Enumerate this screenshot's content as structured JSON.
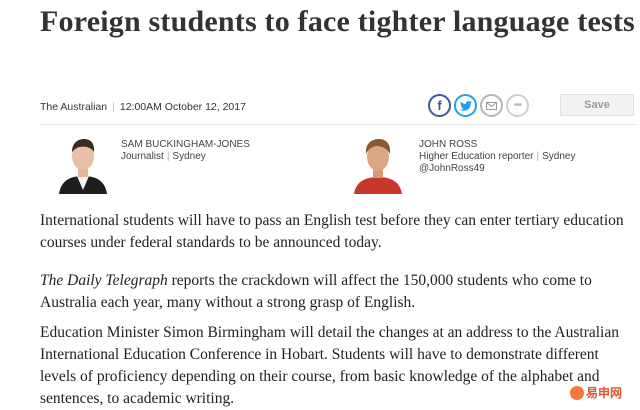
{
  "article": {
    "headline": "Foreign students to face tighter language tests",
    "publication": "The Australian",
    "timestamp": "12:00AM October 12, 2017"
  },
  "toolbar": {
    "facebook_icon": "facebook-icon",
    "twitter_icon": "twitter-icon",
    "email_icon": "email-icon",
    "more_icon": "more-icon",
    "save_label": "Save"
  },
  "authors": [
    {
      "name": "SAM BUCKINGHAM-JONES",
      "role": "Journalist",
      "location": "Sydney",
      "handle": ""
    },
    {
      "name": "JOHN ROSS",
      "role": "Higher Education reporter",
      "location": "Sydney",
      "handle": "@JohnRoss49"
    }
  ],
  "body": {
    "p1": "International students will have to pass an English test before they can enter tertiary education courses under federal standards to be announced today.",
    "p2_italic": "The Daily Telegraph",
    "p2_rest": " reports the crackdown will affect the 150,000 students who come to Australia each year, many without a strong grasp of English.",
    "p3": "Education Minister Simon Birmingham will detail the changes at an address to the Australian International Education Conference in Hobart. Students will have to demonstrate different levels of proficiency depending on their course, from basic knowledge of the alphabet and sentences, to academic writing."
  },
  "watermark": {
    "text": "易申网"
  },
  "colors": {
    "facebook": "#3b5998",
    "twitter": "#1da1f2",
    "watermark": "#e0552b"
  }
}
